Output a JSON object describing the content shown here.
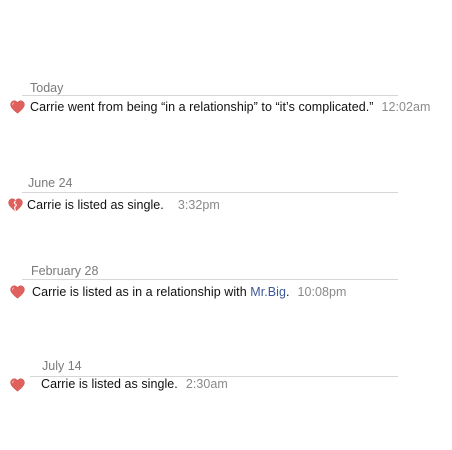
{
  "feed": {
    "entries": [
      {
        "date": "Today",
        "text": "Carrie went from being “in a relationship” to “it’s complicated.”",
        "time": "12:02am",
        "icon": "heart-icon"
      },
      {
        "date": "June 24",
        "text": "Carrie is listed as single.",
        "time": "3:32pm",
        "icon": "broken-heart-icon"
      },
      {
        "date": "February 28",
        "text_before": "Carrie is listed as in a relationship with",
        "link": "Mr.Big",
        "text_after": ".",
        "time": "10:08pm",
        "icon": "heart-icon"
      },
      {
        "date": "July 14",
        "text": "Carrie is listed as single.",
        "time": "2:30am",
        "icon": "heart-icon"
      }
    ],
    "colors": {
      "heart": "#e0605e",
      "link": "#3b5998",
      "date": "#7a7a7a",
      "time": "#8a8a8a"
    }
  }
}
